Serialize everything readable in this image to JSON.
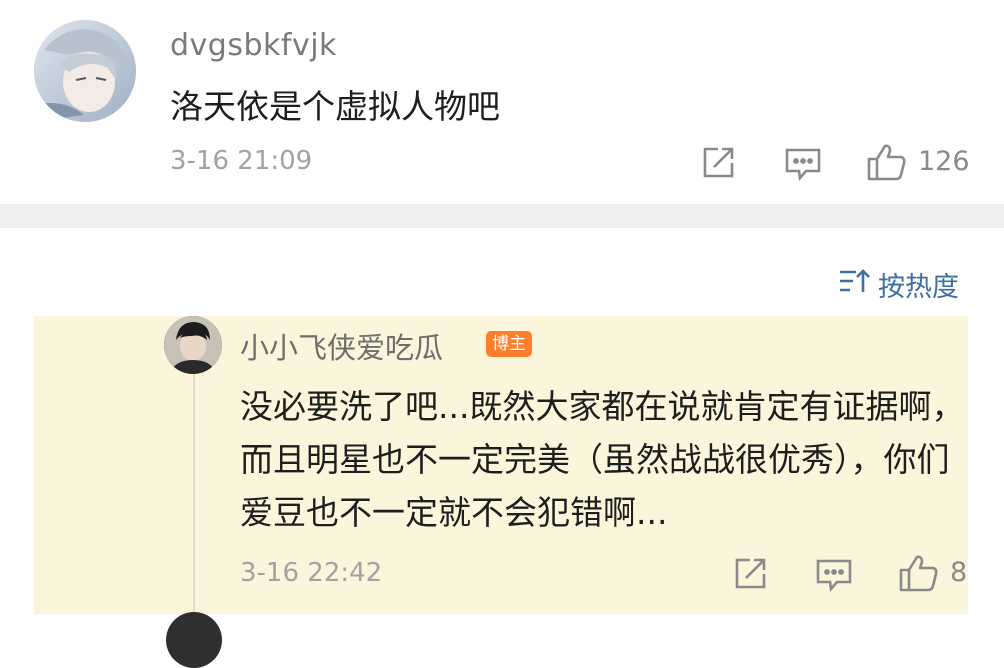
{
  "comment1": {
    "username": "dvgsbkfvjk",
    "text": "洛天依是个虚拟人物吧",
    "time": "3-16 21:09",
    "likes": "126",
    "icons": [
      "share-icon",
      "comment-icon",
      "thumbs-up-icon"
    ]
  },
  "sort": {
    "icon": "sort-icon",
    "label": "按热度",
    "color": "#3d6fa3"
  },
  "reply": {
    "username": "小小飞侠爱吃瓜",
    "badge": "博主",
    "badge_color": "#ff7d2c",
    "text": "没必要洗了吧...既然大家都在说就肯定有证据啊，而且明星也不一定完美（虽然战战很优秀），你们爱豆也不一定就不会犯错啊...",
    "time": "3-16 22:42",
    "likes": "8",
    "highlight_color": "#fbf5dc",
    "icons": [
      "share-icon",
      "comment-icon",
      "thumbs-up-icon"
    ]
  }
}
